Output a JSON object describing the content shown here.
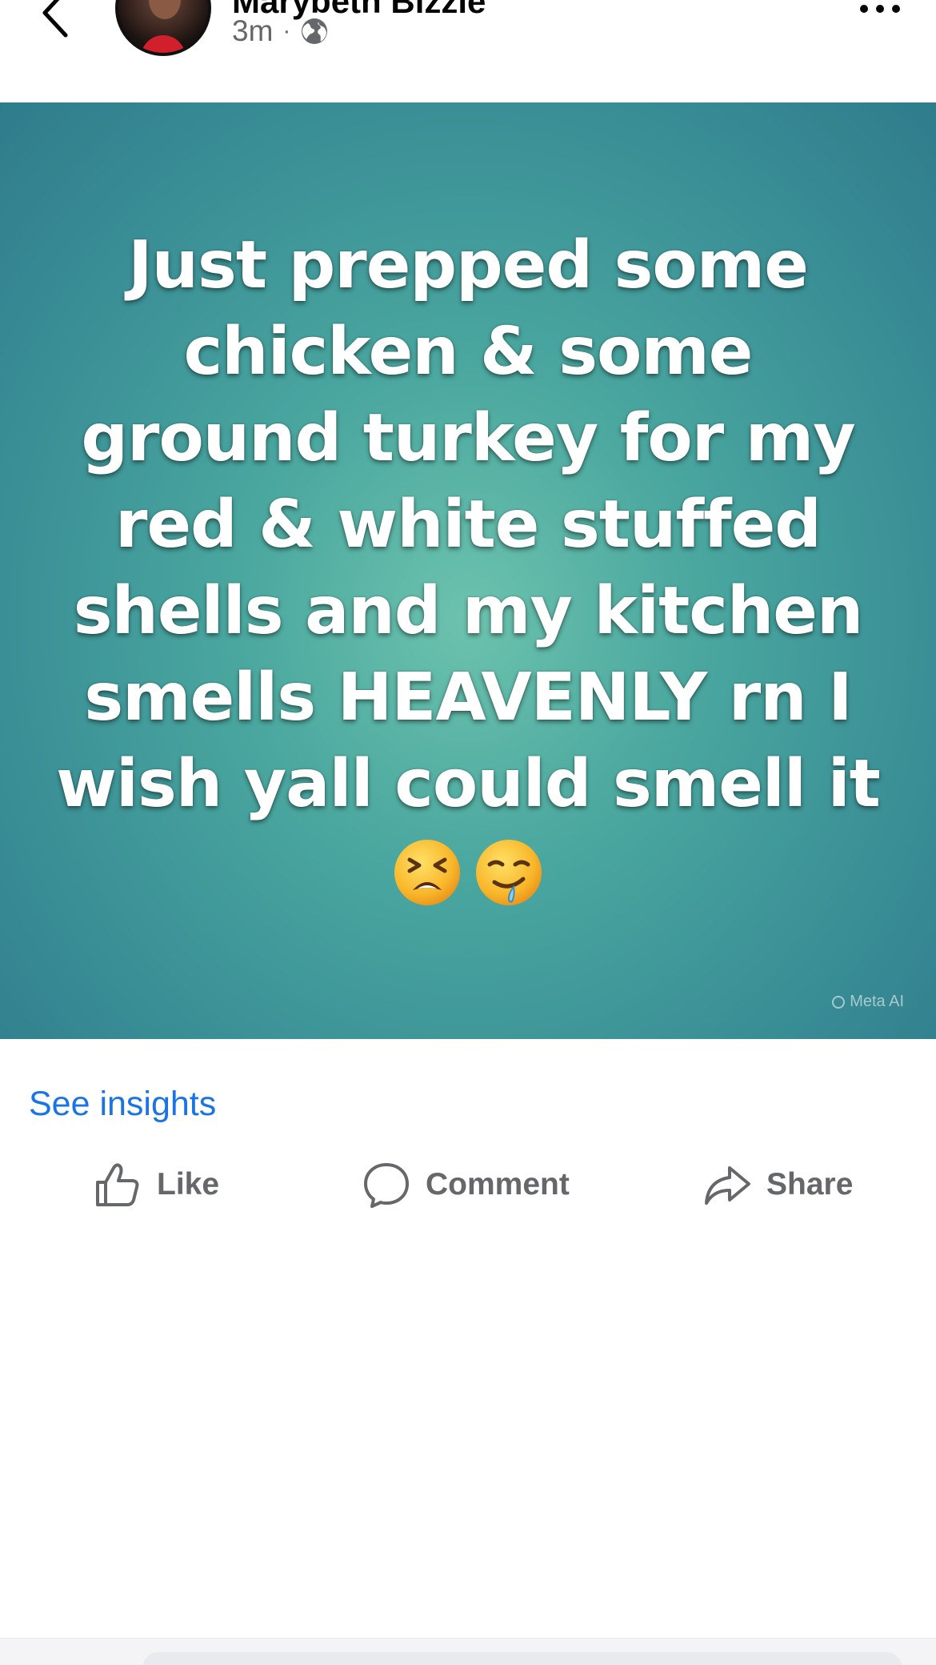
{
  "header": {
    "author_name": "Marybeth Bizzie",
    "timestamp": "3m",
    "separator": "·",
    "audience_icon": "globe-icon",
    "back_icon": "chevron-left-icon",
    "more_icon": "ellipsis-icon"
  },
  "post": {
    "text": "Just prepped some chicken & some ground turkey for my red & white stuffed shells and my kitchen smells HEAVENLY rn I wish yall could smell it",
    "emojis": [
      "tired-face-emoji",
      "drooling-face-emoji"
    ],
    "watermark": "Meta AI",
    "background_colors": [
      "#6cc2ad",
      "#3a8f96",
      "#2f7c8c"
    ]
  },
  "insights": {
    "label": "See insights",
    "color": "#1b74e4"
  },
  "actions": {
    "like_label": "Like",
    "comment_label": "Comment",
    "share_label": "Share",
    "color": "#65676b"
  }
}
